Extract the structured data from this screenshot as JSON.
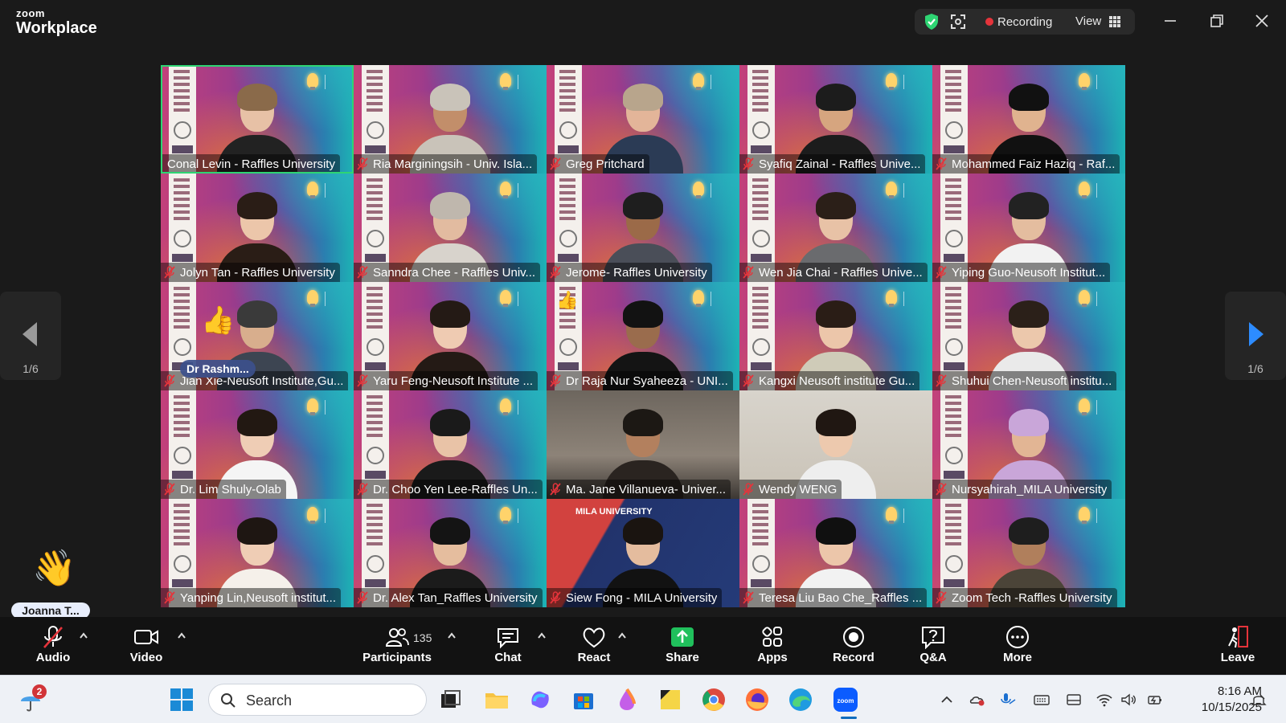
{
  "app": {
    "brand_top": "zoom",
    "brand_bottom": "Workplace"
  },
  "top_controls": {
    "recording_label": "Recording",
    "view_label": "View"
  },
  "gallery": {
    "page_left": "1/6",
    "page_right": "1/6",
    "tiles": [
      {
        "name": "Conal Levin - Raffles University",
        "bg": "conf",
        "skin": "#e7c1a6",
        "hair": "#8a6a4a",
        "shirt": "#222",
        "muted": false,
        "active": true
      },
      {
        "name": "Ria Marginingsih - Univ. Isla...",
        "bg": "conf",
        "skin": "#c28e6a",
        "hair": "#c9c3b9",
        "shirt": "#c9c3b9",
        "muted": true
      },
      {
        "name": "Greg Pritchard",
        "bg": "conf",
        "skin": "#e3b599",
        "hair": "#b8a58c",
        "shirt": "#2b3b55",
        "muted": true
      },
      {
        "name": "Syafiq Zainal - Raffles Unive...",
        "bg": "conf",
        "skin": "#d6a57f",
        "hair": "#1c1c1c",
        "shirt": "#1c1c1c",
        "muted": true
      },
      {
        "name": "Mohammed Faiz Haziq - Raf...",
        "bg": "conf",
        "skin": "#e0b38f",
        "hair": "#111",
        "shirt": "#111",
        "muted": true
      },
      {
        "name": "Jolyn Tan - Raffles University",
        "bg": "conf",
        "skin": "#ecc6aa",
        "hair": "#2a1d16",
        "shirt": "#2a1d16",
        "muted": true
      },
      {
        "name": "Sanndra Chee - Raffles Univ...",
        "bg": "conf",
        "skin": "#e2bba0",
        "hair": "#bfb7ad",
        "shirt": "#d8d3cc",
        "muted": true
      },
      {
        "name": "Jerome- Raffles University",
        "bg": "conf",
        "skin": "#9b6a48",
        "hair": "#1e1e1e",
        "shirt": "#4a4e58",
        "muted": true
      },
      {
        "name": "Wen Jia Chai - Raffles Unive...",
        "bg": "conf",
        "skin": "#e8c2a6",
        "hair": "#2b1f18",
        "shirt": "#6a6b6e",
        "muted": true
      },
      {
        "name": "Yiping Guo-Neusoft Institut...",
        "bg": "conf",
        "skin": "#e4bd9f",
        "hair": "#222",
        "shirt": "#f2f2f2",
        "muted": true
      },
      {
        "name": "Jian Xie-Neusoft Institute,Gu...",
        "bg": "conf",
        "skin": "#d8ae8d",
        "hair": "#3a3a3a",
        "shirt": "#3d4552",
        "muted": true,
        "overlay": "Dr Rashm...",
        "emoji": "👍"
      },
      {
        "name": "Yaru Feng-Neusoft Institute ...",
        "bg": "conf",
        "skin": "#efcbb2",
        "hair": "#241a15",
        "shirt": "#241a15",
        "muted": true
      },
      {
        "name": "Dr Raja Nur Syaheeza - UNI...",
        "bg": "conf",
        "skin": "#9a6c4d",
        "hair": "#121212",
        "shirt": "#141414",
        "muted": true,
        "emoji_small": "👍"
      },
      {
        "name": "Kangxi Neusoft institute Gu...",
        "bg": "conf",
        "skin": "#ecc6aa",
        "hair": "#2a1d16",
        "shirt": "#cfcbb8",
        "muted": true
      },
      {
        "name": "Shuhui Chen-Neusoft institu...",
        "bg": "conf",
        "skin": "#ecc8ac",
        "hair": "#2b2019",
        "shirt": "#eaeaea",
        "muted": true
      },
      {
        "name": "Dr. Lim Shuly-Olab",
        "bg": "conf",
        "skin": "#efcdb5",
        "hair": "#221812",
        "shirt": "#f5f5f5",
        "muted": true
      },
      {
        "name": "Dr. Choo Yen Lee-Raffles Un...",
        "bg": "conf",
        "skin": "#e9c3a7",
        "hair": "#1a1a1a",
        "shirt": "#1a1a1a",
        "muted": true
      },
      {
        "name": "Ma. Jane Villanueva- Univer...",
        "bg": "plain-dark",
        "skin": "#b3805e",
        "hair": "#1c1814",
        "shirt": "#2a2420",
        "muted": true
      },
      {
        "name": "Wendy WENG",
        "bg": "plain-light",
        "skin": "#edc9ae",
        "hair": "#201712",
        "shirt": "#eeeeee",
        "muted": true
      },
      {
        "name": "Nursyahirah_MILA University",
        "bg": "conf",
        "skin": "#e2b594",
        "hair": "#c9a6d9",
        "shirt": "#c9a6d9",
        "muted": true
      },
      {
        "name": "Yanping Lin,Neusoft institut...",
        "bg": "conf",
        "skin": "#efcdb5",
        "hair": "#1e1612",
        "shirt": "#f5f0ea",
        "muted": true
      },
      {
        "name": "Dr. Alex Tan_Raffles University",
        "bg": "conf",
        "skin": "#e5bd9e",
        "hair": "#141414",
        "shirt": "#1b1b1b",
        "muted": true
      },
      {
        "name": "Siew Fong - MILA University",
        "bg": "mila",
        "skin": "#e4bc9e",
        "hair": "#1a1410",
        "shirt": "#121212",
        "muted": true,
        "banner": "MILA UNIVERSITY"
      },
      {
        "name": "Teresa Liu Bao Che_Raffles ...",
        "bg": "conf",
        "skin": "#ecc6aa",
        "hair": "#101010",
        "shirt": "#f2f2f2",
        "muted": true
      },
      {
        "name": "Zoom Tech -Raffles University",
        "bg": "conf",
        "skin": "#b07f5c",
        "hair": "#1e1e1e",
        "shirt": "#4b4438",
        "muted": true
      }
    ]
  },
  "raised_hand": {
    "emoji": "👋",
    "name": "Joanna T..."
  },
  "toolbar": {
    "audio": "Audio",
    "video": "Video",
    "participants": "Participants",
    "participants_count": "135",
    "chat": "Chat",
    "react": "React",
    "share": "Share",
    "apps": "Apps",
    "record": "Record",
    "qa": "Q&A",
    "more": "More",
    "leave": "Leave"
  },
  "taskbar": {
    "search_placeholder": "Search",
    "time": "8:16 AM",
    "date": "10/15/2025",
    "weather_badge": "2"
  },
  "colors": {
    "accent_green": "#2ed573",
    "record_red": "#e5343b",
    "share_green": "#20c05c",
    "leave_red": "#e5343b"
  }
}
